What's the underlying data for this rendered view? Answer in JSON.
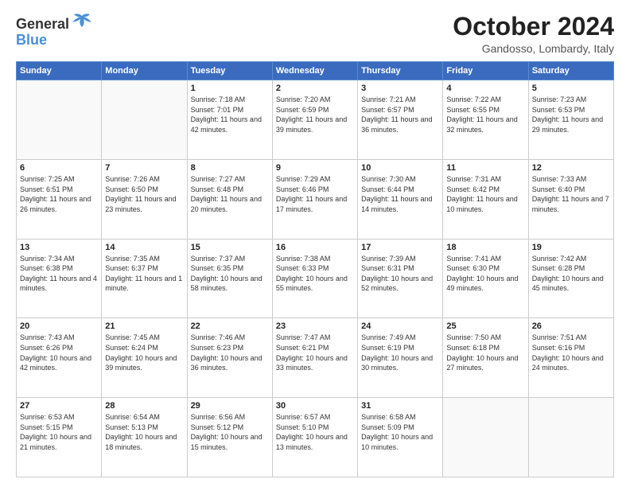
{
  "header": {
    "logo_line1": "General",
    "logo_line2": "Blue",
    "month": "October 2024",
    "location": "Gandosso, Lombardy, Italy"
  },
  "days_of_week": [
    "Sunday",
    "Monday",
    "Tuesday",
    "Wednesday",
    "Thursday",
    "Friday",
    "Saturday"
  ],
  "weeks": [
    [
      {
        "day": "",
        "info": ""
      },
      {
        "day": "",
        "info": ""
      },
      {
        "day": "1",
        "info": "Sunrise: 7:18 AM\nSunset: 7:01 PM\nDaylight: 11 hours\nand 42 minutes."
      },
      {
        "day": "2",
        "info": "Sunrise: 7:20 AM\nSunset: 6:59 PM\nDaylight: 11 hours\nand 39 minutes."
      },
      {
        "day": "3",
        "info": "Sunrise: 7:21 AM\nSunset: 6:57 PM\nDaylight: 11 hours\nand 36 minutes."
      },
      {
        "day": "4",
        "info": "Sunrise: 7:22 AM\nSunset: 6:55 PM\nDaylight: 11 hours\nand 32 minutes."
      },
      {
        "day": "5",
        "info": "Sunrise: 7:23 AM\nSunset: 6:53 PM\nDaylight: 11 hours\nand 29 minutes."
      }
    ],
    [
      {
        "day": "6",
        "info": "Sunrise: 7:25 AM\nSunset: 6:51 PM\nDaylight: 11 hours\nand 26 minutes."
      },
      {
        "day": "7",
        "info": "Sunrise: 7:26 AM\nSunset: 6:50 PM\nDaylight: 11 hours\nand 23 minutes."
      },
      {
        "day": "8",
        "info": "Sunrise: 7:27 AM\nSunset: 6:48 PM\nDaylight: 11 hours\nand 20 minutes."
      },
      {
        "day": "9",
        "info": "Sunrise: 7:29 AM\nSunset: 6:46 PM\nDaylight: 11 hours\nand 17 minutes."
      },
      {
        "day": "10",
        "info": "Sunrise: 7:30 AM\nSunset: 6:44 PM\nDaylight: 11 hours\nand 14 minutes."
      },
      {
        "day": "11",
        "info": "Sunrise: 7:31 AM\nSunset: 6:42 PM\nDaylight: 11 hours\nand 10 minutes."
      },
      {
        "day": "12",
        "info": "Sunrise: 7:33 AM\nSunset: 6:40 PM\nDaylight: 11 hours\nand 7 minutes."
      }
    ],
    [
      {
        "day": "13",
        "info": "Sunrise: 7:34 AM\nSunset: 6:38 PM\nDaylight: 11 hours\nand 4 minutes."
      },
      {
        "day": "14",
        "info": "Sunrise: 7:35 AM\nSunset: 6:37 PM\nDaylight: 11 hours\nand 1 minute."
      },
      {
        "day": "15",
        "info": "Sunrise: 7:37 AM\nSunset: 6:35 PM\nDaylight: 10 hours\nand 58 minutes."
      },
      {
        "day": "16",
        "info": "Sunrise: 7:38 AM\nSunset: 6:33 PM\nDaylight: 10 hours\nand 55 minutes."
      },
      {
        "day": "17",
        "info": "Sunrise: 7:39 AM\nSunset: 6:31 PM\nDaylight: 10 hours\nand 52 minutes."
      },
      {
        "day": "18",
        "info": "Sunrise: 7:41 AM\nSunset: 6:30 PM\nDaylight: 10 hours\nand 49 minutes."
      },
      {
        "day": "19",
        "info": "Sunrise: 7:42 AM\nSunset: 6:28 PM\nDaylight: 10 hours\nand 45 minutes."
      }
    ],
    [
      {
        "day": "20",
        "info": "Sunrise: 7:43 AM\nSunset: 6:26 PM\nDaylight: 10 hours\nand 42 minutes."
      },
      {
        "day": "21",
        "info": "Sunrise: 7:45 AM\nSunset: 6:24 PM\nDaylight: 10 hours\nand 39 minutes."
      },
      {
        "day": "22",
        "info": "Sunrise: 7:46 AM\nSunset: 6:23 PM\nDaylight: 10 hours\nand 36 minutes."
      },
      {
        "day": "23",
        "info": "Sunrise: 7:47 AM\nSunset: 6:21 PM\nDaylight: 10 hours\nand 33 minutes."
      },
      {
        "day": "24",
        "info": "Sunrise: 7:49 AM\nSunset: 6:19 PM\nDaylight: 10 hours\nand 30 minutes."
      },
      {
        "day": "25",
        "info": "Sunrise: 7:50 AM\nSunset: 6:18 PM\nDaylight: 10 hours\nand 27 minutes."
      },
      {
        "day": "26",
        "info": "Sunrise: 7:51 AM\nSunset: 6:16 PM\nDaylight: 10 hours\nand 24 minutes."
      }
    ],
    [
      {
        "day": "27",
        "info": "Sunrise: 6:53 AM\nSunset: 5:15 PM\nDaylight: 10 hours\nand 21 minutes."
      },
      {
        "day": "28",
        "info": "Sunrise: 6:54 AM\nSunset: 5:13 PM\nDaylight: 10 hours\nand 18 minutes."
      },
      {
        "day": "29",
        "info": "Sunrise: 6:56 AM\nSunset: 5:12 PM\nDaylight: 10 hours\nand 15 minutes."
      },
      {
        "day": "30",
        "info": "Sunrise: 6:57 AM\nSunset: 5:10 PM\nDaylight: 10 hours\nand 13 minutes."
      },
      {
        "day": "31",
        "info": "Sunrise: 6:58 AM\nSunset: 5:09 PM\nDaylight: 10 hours\nand 10 minutes."
      },
      {
        "day": "",
        "info": ""
      },
      {
        "day": "",
        "info": ""
      }
    ]
  ]
}
